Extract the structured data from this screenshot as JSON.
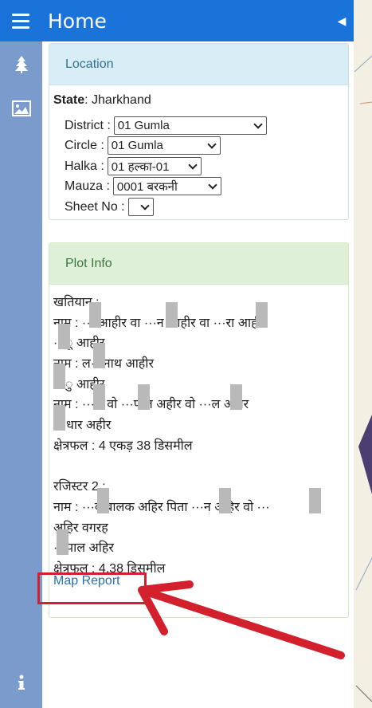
{
  "header": {
    "title": "Home"
  },
  "location": {
    "heading": "Location",
    "state_label": "State",
    "state_value": ": Jharkhand",
    "district_label": "District :",
    "district_value": "01 Gumla",
    "circle_label": "Circle :",
    "circle_value": "01 Gumla",
    "halka_label": "Halka :",
    "halka_value": "01 हल्का-01",
    "mauza_label": "Mauza :",
    "mauza_value": "0001 बरकनी",
    "sheet_label": "Sheet No :",
    "sheet_value": ""
  },
  "plot_info": {
    "heading": "Plot Info",
    "lines": [
      "खतियान :",
      "नाम : ··· आहीर वा ···न आहीर वा ···रा आहीर",
      "···ू आहीर",
      "नाम : ल···नाथ आहीर",
      "···ु आहीर",
      "नाम : ···ल वो ···पाल अहीर वो ···ल अहीर",
      "···धार अहीर",
      "क्षेत्रफल : 4 एकड़ 38 डिसमील",
      "",
      "रजिस्टर 2 :",
      "नाम : ···व बालक अहिर पिता ···न अहिर वो ···",
      "अहिर वगरह",
      "···पाल अहिर",
      "क्षेत्रफल : 4.38 डिसमील"
    ],
    "map_report_label": "Map Report"
  },
  "icons": {
    "menu": "menu-icon",
    "collapse": "collapse-left-icon",
    "layers": "tree-icon",
    "image": "image-icon",
    "info": "info-icon"
  },
  "colors": {
    "header": "#1a73d9",
    "strip": "#7a9bcc",
    "annotation": "#d2202c"
  }
}
